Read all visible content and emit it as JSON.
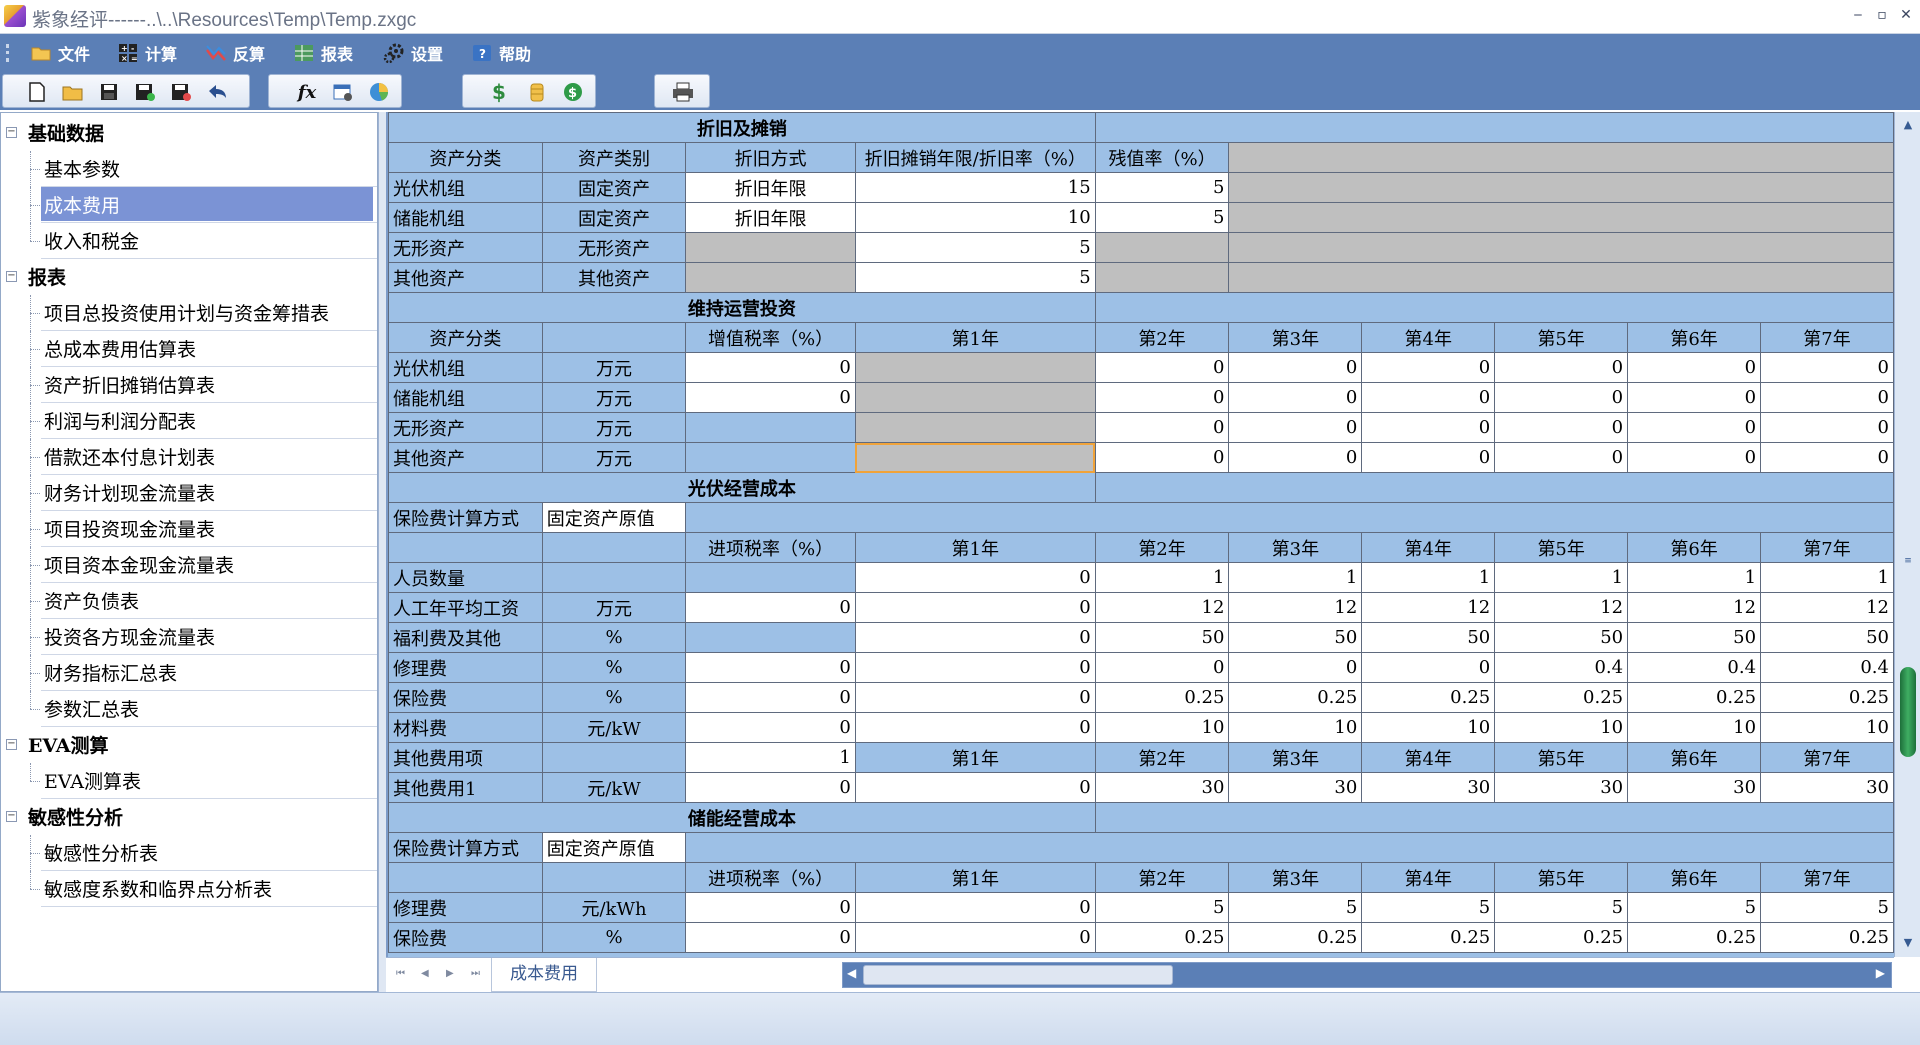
{
  "window": {
    "title": "紫象经评------..\\..\\Resources\\Temp\\Temp.zxgc",
    "controls": [
      "‒",
      "▫",
      "✕"
    ]
  },
  "menu": [
    {
      "label": "文件",
      "icon": "folder-icon"
    },
    {
      "label": "计算",
      "icon": "calculator-icon"
    },
    {
      "label": "反算",
      "icon": "back-calc-icon"
    },
    {
      "label": "报表",
      "icon": "report-icon"
    },
    {
      "label": "设置",
      "icon": "gear-icon"
    },
    {
      "label": "帮助",
      "icon": "help-icon"
    }
  ],
  "toolbar": {
    "groups": [
      {
        "buttons": [
          "new-file-icon",
          "open-folder-icon",
          "save-icon",
          "save-as-icon",
          "save-close-icon",
          "undo-icon"
        ]
      },
      {
        "buttons": [
          "formula-icon",
          "calc-settings-icon",
          "chart-icon"
        ]
      },
      {
        "buttons": [
          "dollar-icon",
          "coins-icon",
          "money-icon"
        ]
      },
      {
        "buttons": [
          "printer-icon"
        ]
      }
    ]
  },
  "tree": [
    {
      "label": "基础数据",
      "level": 0,
      "expander": "⊟"
    },
    {
      "label": "基本参数",
      "level": 1
    },
    {
      "label": "成本费用",
      "level": 1,
      "selected": true
    },
    {
      "label": "收入和税金",
      "level": 1
    },
    {
      "label": "报表",
      "level": 0,
      "expander": "⊟"
    },
    {
      "label": "项目总投资使用计划与资金筹措表",
      "level": 1
    },
    {
      "label": "总成本费用估算表",
      "level": 1
    },
    {
      "label": "资产折旧摊销估算表",
      "level": 1
    },
    {
      "label": "利润与利润分配表",
      "level": 1
    },
    {
      "label": "借款还本付息计划表",
      "level": 1
    },
    {
      "label": "财务计划现金流量表",
      "level": 1
    },
    {
      "label": "项目投资现金流量表",
      "level": 1
    },
    {
      "label": "项目资本金现金流量表",
      "level": 1
    },
    {
      "label": "资产负债表",
      "level": 1
    },
    {
      "label": "投资各方现金流量表",
      "level": 1
    },
    {
      "label": "财务指标汇总表",
      "level": 1
    },
    {
      "label": "参数汇总表",
      "level": 1
    },
    {
      "label": "EVA测算",
      "level": 0,
      "expander": "⊟"
    },
    {
      "label": "EVA测算表",
      "level": 1
    },
    {
      "label": "敏感性分析",
      "level": 0,
      "expander": "⊟"
    },
    {
      "label": "敏感性分析表",
      "level": 1
    },
    {
      "label": "敏感度系数和临界点分析表",
      "level": 1
    }
  ],
  "grid": {
    "depreciation": {
      "title": "折旧及摊销",
      "headers": [
        "资产分类",
        "资产类别",
        "折旧方式",
        "折旧摊销年限/折旧率（%）",
        "残值率（%）"
      ],
      "rows": [
        {
          "name": "光伏机组",
          "category": "固定资产",
          "method": "折旧年限",
          "years": "15",
          "residual": "5"
        },
        {
          "name": "储能机组",
          "category": "固定资产",
          "method": "折旧年限",
          "years": "10",
          "residual": "5"
        },
        {
          "name": "无形资产",
          "category": "无形资产",
          "method": "",
          "years": "5",
          "residual": ""
        },
        {
          "name": "其他资产",
          "category": "其他资产",
          "method": "",
          "years": "5",
          "residual": ""
        }
      ]
    },
    "maintenance": {
      "title": "维持运营投资",
      "headers": [
        "资产分类",
        "",
        "增值税率（%）",
        "第1年",
        "第2年",
        "第3年",
        "第4年",
        "第5年",
        "第6年",
        "第7年"
      ],
      "rows": [
        {
          "name": "光伏机组",
          "unit": "万元",
          "tax": "0",
          "vals": [
            "0",
            "0",
            "0",
            "0",
            "0",
            "0"
          ]
        },
        {
          "name": "储能机组",
          "unit": "万元",
          "tax": "0",
          "vals": [
            "0",
            "0",
            "0",
            "0",
            "0",
            "0"
          ]
        },
        {
          "name": "无形资产",
          "unit": "万元",
          "tax": "",
          "vals": [
            "0",
            "0",
            "0",
            "0",
            "0",
            "0"
          ]
        },
        {
          "name": "其他资产",
          "unit": "万元",
          "tax": "",
          "vals": [
            "0",
            "0",
            "0",
            "0",
            "0",
            "0"
          ]
        }
      ]
    },
    "pv_cost": {
      "title": "光伏经营成本",
      "insurance_label": "保险费计算方式",
      "insurance_value": "固定资产原值",
      "headers": [
        "进项税率（%）",
        "第1年",
        "第2年",
        "第3年",
        "第4年",
        "第5年",
        "第6年",
        "第7年"
      ],
      "rows": [
        {
          "name": "人员数量",
          "unit": "",
          "tax": "",
          "vals": [
            "0",
            "1",
            "1",
            "1",
            "1",
            "1",
            "1"
          ]
        },
        {
          "name": "人工年平均工资",
          "unit": "万元",
          "tax": "0",
          "vals": [
            "0",
            "12",
            "12",
            "12",
            "12",
            "12",
            "12"
          ]
        },
        {
          "name": "福利费及其他",
          "unit": "%",
          "tax": "",
          "vals": [
            "0",
            "50",
            "50",
            "50",
            "50",
            "50",
            "50"
          ]
        },
        {
          "name": "修理费",
          "unit": "%",
          "tax": "0",
          "vals": [
            "0",
            "0",
            "0",
            "0",
            "0.4",
            "0.4",
            "0.4"
          ]
        },
        {
          "name": "保险费",
          "unit": "%",
          "tax": "0",
          "vals": [
            "0",
            "0.25",
            "0.25",
            "0.25",
            "0.25",
            "0.25",
            "0.25"
          ]
        },
        {
          "name": "材料费",
          "unit": "元/kW",
          "tax": "0",
          "vals": [
            "0",
            "10",
            "10",
            "10",
            "10",
            "10",
            "10"
          ]
        }
      ],
      "other_label": "其他费用项",
      "other_count": "1",
      "other_rows": [
        {
          "name": "其他费用1",
          "unit": "元/kW",
          "tax": "0",
          "vals": [
            "0",
            "30",
            "30",
            "30",
            "30",
            "30",
            "30"
          ]
        }
      ]
    },
    "storage_cost": {
      "title": "储能经营成本",
      "insurance_label": "保险费计算方式",
      "insurance_value": "固定资产原值",
      "headers": [
        "进项税率（%）",
        "第1年",
        "第2年",
        "第3年",
        "第4年",
        "第5年",
        "第6年",
        "第7年"
      ],
      "rows": [
        {
          "name": "修理费",
          "unit": "元/kWh",
          "tax": "0",
          "vals": [
            "0",
            "5",
            "5",
            "5",
            "5",
            "5",
            "5"
          ]
        },
        {
          "name": "保险费",
          "unit": "%",
          "tax": "0",
          "vals": [
            "0",
            "0.25",
            "0.25",
            "0.25",
            "0.25",
            "0.25",
            "0.25"
          ]
        }
      ]
    }
  },
  "sheet_tabs": [
    "成本费用"
  ],
  "nav_buttons": [
    "⏮",
    "◀",
    "▶",
    "⏭"
  ],
  "colors": {
    "accent": "#5b7fb6",
    "header_cell": "#9dc0e6",
    "locked_cell": "#bfbfbf",
    "tree_selected": "#7b93d5"
  }
}
